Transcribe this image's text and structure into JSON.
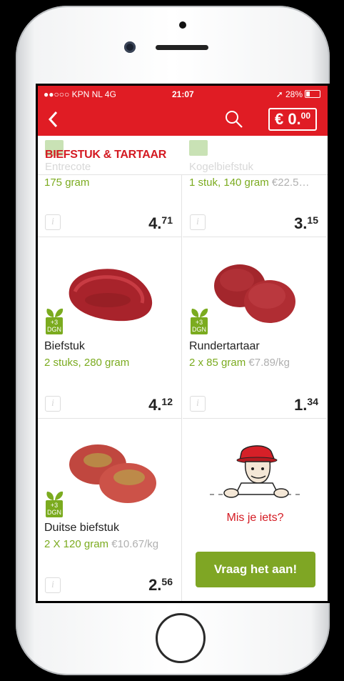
{
  "status_bar": {
    "carrier": "●●○○○ KPN NL  4G",
    "time": "21:07",
    "battery": "28%"
  },
  "nav": {
    "cart_amount": "€ 0.",
    "cart_cents": "00"
  },
  "category": {
    "title": "BIEFSTUK & TARTAAR",
    "ghost_left": "Entrecote",
    "ghost_right": "Kogelbiefstuk"
  },
  "products": [
    {
      "name": "",
      "subtitle": "175 gram",
      "unit_price": "",
      "price_euros": "4.",
      "price_cents": "71"
    },
    {
      "name": "",
      "subtitle": "1 stuk, 140 gram",
      "unit_price": "€22.5…",
      "price_euros": "3.",
      "price_cents": "15"
    },
    {
      "name": "Biefstuk",
      "subtitle": "2 stuks, 280 gram",
      "unit_price": "",
      "price_euros": "4.",
      "price_cents": "12",
      "badge": "+3\nDGN"
    },
    {
      "name": "Rundertartaar",
      "subtitle": "2 x 85 gram",
      "unit_price": "€7.89/kg",
      "price_euros": "1.",
      "price_cents": "34",
      "badge": "+3\nDGN"
    },
    {
      "name": "Duitse biefstuk",
      "subtitle": "2 X 120 gram",
      "unit_price": "€10.67/kg",
      "price_euros": "2.",
      "price_cents": "56",
      "badge": "+3\nDGN"
    }
  ],
  "badge_text": {
    "line1": "+3",
    "line2": "DGN"
  },
  "info_glyph": "i",
  "missing": {
    "text": "Mis je iets?",
    "button": "Vraag het aan!"
  },
  "colors": {
    "brand_red": "#e01c24",
    "green": "#7bab1f",
    "button_green": "#7fa624"
  },
  "icons": [
    "back-icon",
    "search-icon",
    "info-icon",
    "eco-leaf-icon",
    "home-button"
  ]
}
